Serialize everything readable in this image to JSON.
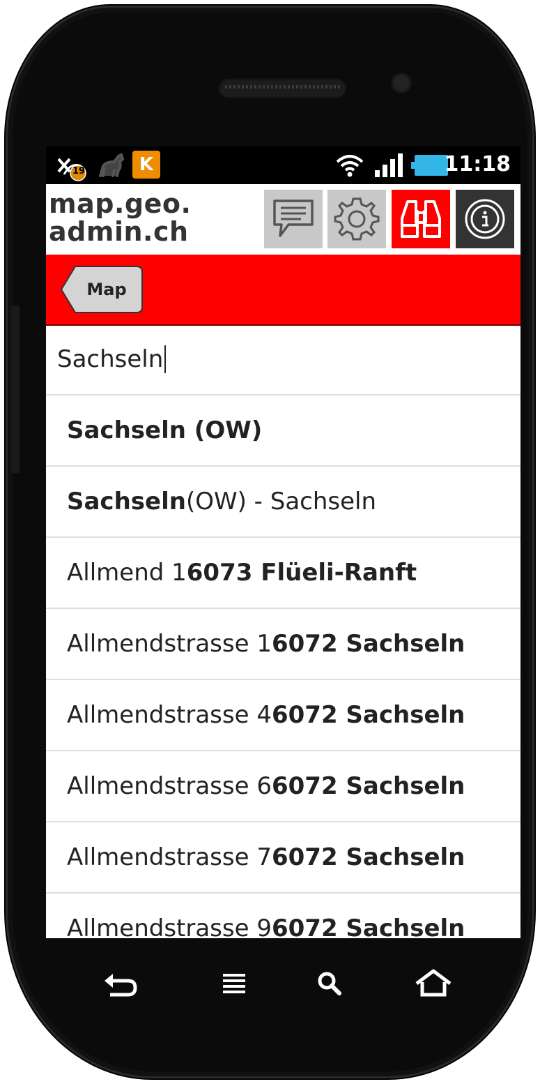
{
  "status_bar": {
    "time": "11:18",
    "notification_badge": "19",
    "app_icon_label": "K",
    "icons": [
      "missed-call-icon",
      "deer-icon",
      "app-icon",
      "wifi-icon",
      "signal-icon",
      "battery-icon"
    ]
  },
  "header": {
    "logo_line1": "map.geo.",
    "logo_line2": "admin.ch",
    "buttons": [
      "feedback",
      "settings",
      "search",
      "info"
    ]
  },
  "toolbar": {
    "back_label": "Map",
    "accent_color": "#ff0000"
  },
  "search": {
    "value": "Sachseln"
  },
  "results": [
    {
      "prefix": "",
      "bold": "Sachseln (OW)",
      "suffix": ""
    },
    {
      "prefix": "",
      "bold": "Sachseln",
      "suffix": " (OW) - Sachseln"
    },
    {
      "prefix": "Allmend 1 ",
      "bold": "6073 Flüeli-Ranft",
      "suffix": ""
    },
    {
      "prefix": "Allmendstrasse 1 ",
      "bold": "6072 Sachseln",
      "suffix": ""
    },
    {
      "prefix": "Allmendstrasse 4 ",
      "bold": "6072 Sachseln",
      "suffix": ""
    },
    {
      "prefix": "Allmendstrasse 6 ",
      "bold": "6072 Sachseln",
      "suffix": ""
    },
    {
      "prefix": "Allmendstrasse 7 ",
      "bold": "6072 Sachseln",
      "suffix": ""
    },
    {
      "prefix": "Allmendstrasse 9 ",
      "bold": "6072 Sachseln",
      "suffix": ""
    }
  ],
  "nav_bar": [
    "back-icon",
    "menu-icon",
    "search-icon",
    "home-icon"
  ]
}
